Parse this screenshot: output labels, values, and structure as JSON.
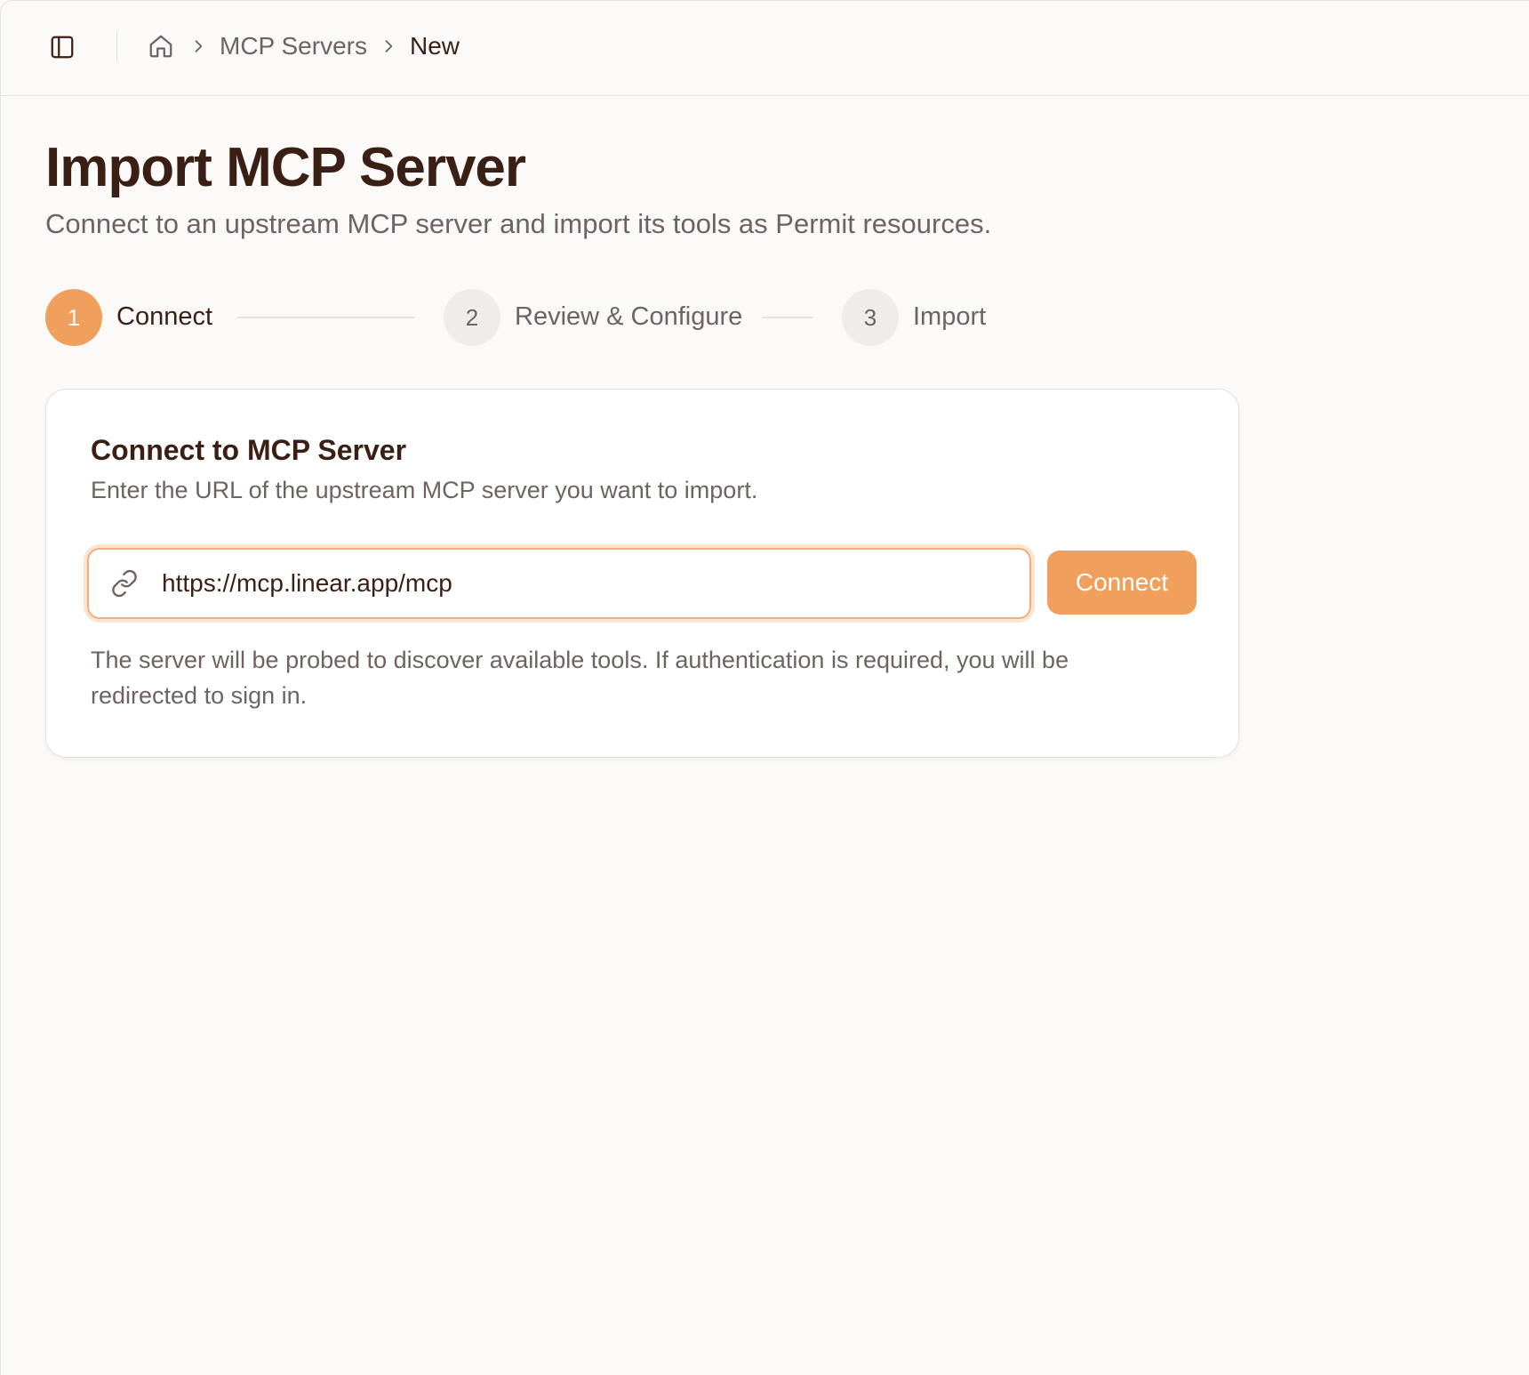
{
  "breadcrumb": {
    "home_icon": "home-icon",
    "items": [
      "MCP Servers",
      "New"
    ]
  },
  "page": {
    "title": "Import MCP Server",
    "subtitle": "Connect to an upstream MCP server and import its tools as Permit resources."
  },
  "stepper": {
    "steps": [
      {
        "number": "1",
        "label": "Connect",
        "state": "active"
      },
      {
        "number": "2",
        "label": "Review & Configure",
        "state": "inactive"
      },
      {
        "number": "3",
        "label": "Import",
        "state": "inactive"
      }
    ]
  },
  "card": {
    "title": "Connect to MCP Server",
    "description": "Enter the URL of the upstream MCP server you want to import.",
    "url_value": "https://mcp.linear.app/mcp",
    "connect_label": "Connect",
    "help_text": "The server will be probed to discover available tools. If authentication is required, you will be redirected to sign in."
  },
  "colors": {
    "accent": "#f0a05c",
    "text_dark": "#3a1f14",
    "text_muted": "#6d6461"
  }
}
